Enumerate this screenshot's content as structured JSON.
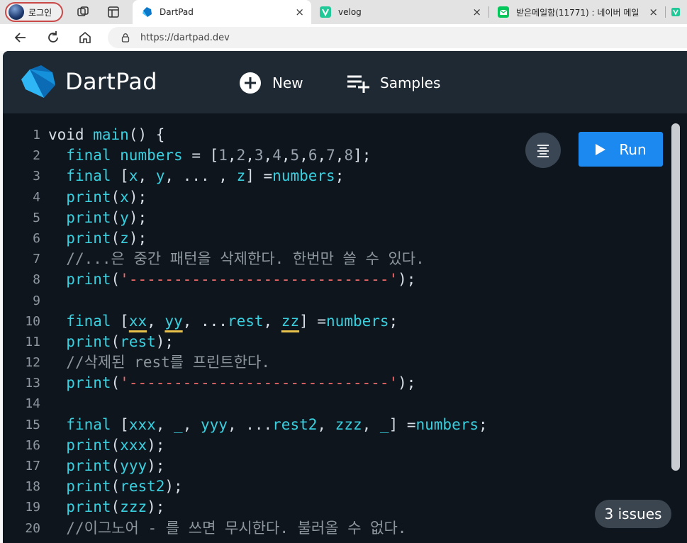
{
  "browser": {
    "profile_label": "로그인",
    "tabs": [
      {
        "title": "DartPad",
        "active": true
      },
      {
        "title": "velog",
        "active": false
      },
      {
        "title": "받은메일함(11771) : 네이버 메일",
        "active": false
      }
    ],
    "tab_close_glyph": "×",
    "url": "https://dartpad.dev"
  },
  "app": {
    "title": "DartPad",
    "new_label": "New",
    "samples_label": "Samples",
    "run_label": "Run",
    "issues_label": "3 issues"
  },
  "editor": {
    "line_numbers": [
      "1",
      "2",
      "3",
      "4",
      "5",
      "6",
      "7",
      "8",
      "9",
      "10",
      "11",
      "12",
      "13",
      "14",
      "15",
      "16",
      "17",
      "18",
      "19",
      "20"
    ],
    "comments": {
      "c7": "//...은 중간 패턴을 삭제한다. 한번만 쓸 수 있다.",
      "c12": "//삭제된 rest를 프린트한다.",
      "c20": "//이그노어 - 를 쓰면 무시한다. 불러올 수 없다."
    },
    "strings": {
      "dashes": "'-----------------------------'"
    }
  },
  "colors": {
    "accent": "#1b89f0",
    "editor_bg": "#0e151d",
    "header_bg": "#1e2934",
    "keyword": "#39d0e0",
    "string": "#f06c6c",
    "warning_underline": "#e8c24a"
  }
}
